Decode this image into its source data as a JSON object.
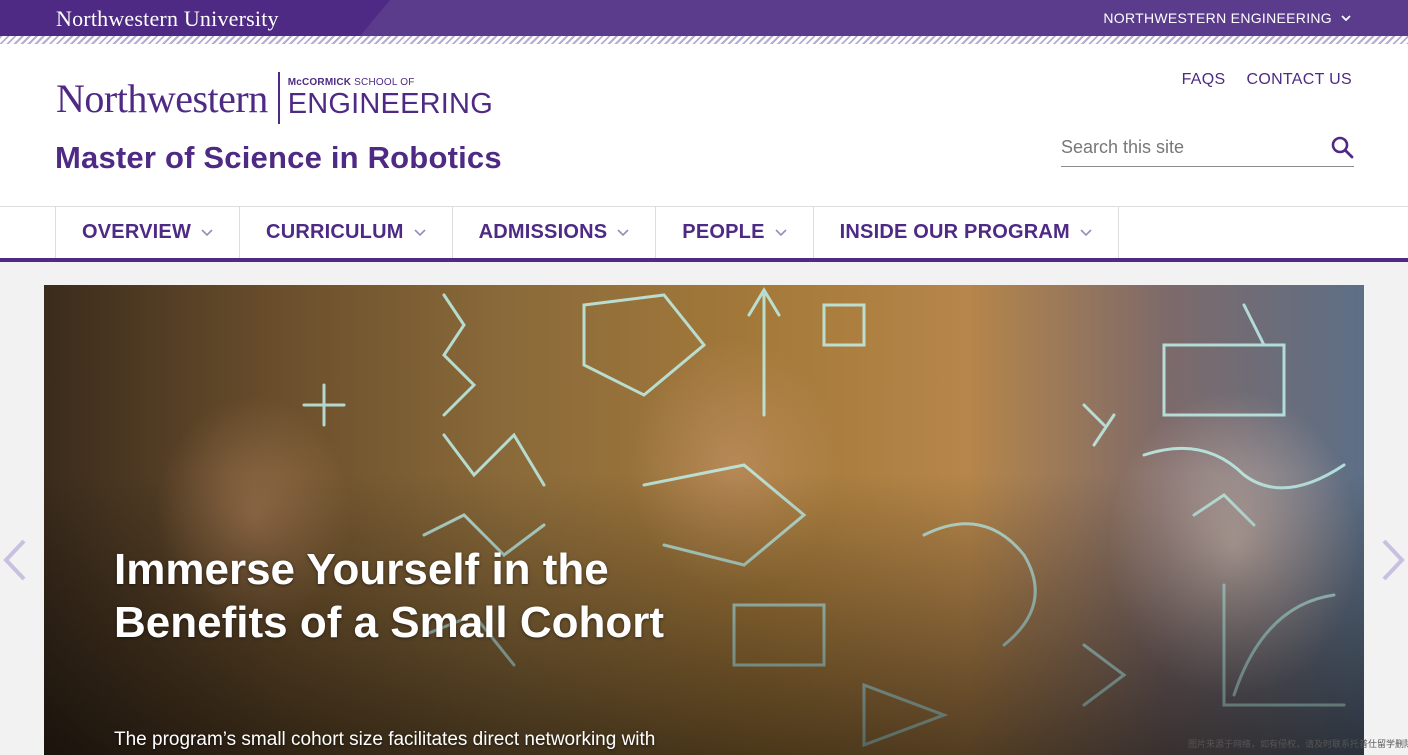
{
  "topbar": {
    "university": "Northwestern University",
    "engineering_link": "NORTHWESTERN ENGINEERING"
  },
  "logo": {
    "northwestern": "Northwestern",
    "mccormick": "McCORMICK",
    "school_of": "SCHOOL OF",
    "engineering": "ENGINEERING"
  },
  "site_title": "Master of Science in Robotics",
  "utility": {
    "faqs": "FAQS",
    "contact": "CONTACT US"
  },
  "search": {
    "placeholder": "Search this site"
  },
  "nav": {
    "items": [
      {
        "label": "OVERVIEW"
      },
      {
        "label": "CURRICULUM"
      },
      {
        "label": "ADMISSIONS"
      },
      {
        "label": "PEOPLE"
      },
      {
        "label": "INSIDE OUR PROGRAM"
      }
    ]
  },
  "hero": {
    "title": "Immerse Yourself in the Benefits of a Small Cohort",
    "subtitle": "The program’s small cohort size facilitates direct networking with"
  },
  "watermark": "图片来源于网络，如有侵权，请及时联系托普仕留学删除",
  "colors": {
    "brand_purple": "#4e2a84",
    "white": "#ffffff"
  }
}
